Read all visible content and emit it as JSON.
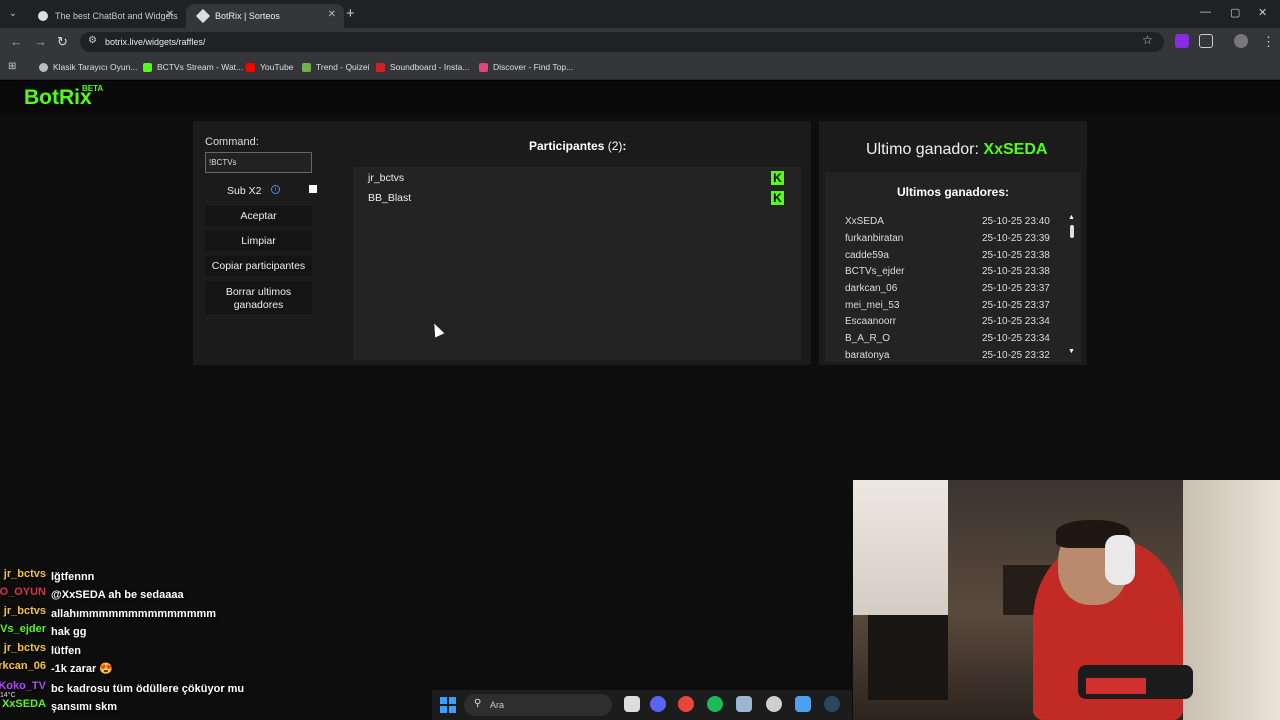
{
  "browser": {
    "tabs": [
      {
        "title": "The best ChatBot and Widgets",
        "active": false
      },
      {
        "title": "BotRix | Sorteos",
        "active": true
      }
    ],
    "url": "botrix.live/widgets/raffles/",
    "bookmarks": [
      {
        "label": "Klasik Tarayıcı Oyun...",
        "color": "#bbbbbb"
      },
      {
        "label": "BCTVs Stream - Wat...",
        "color": "#53fc18"
      },
      {
        "label": "YouTube",
        "color": "#ff0000"
      },
      {
        "label": "Trend - Quizei",
        "color": "#6fb04f"
      },
      {
        "label": "Soundboard - Insta...",
        "color": "#d42020"
      },
      {
        "label": "Discover - Find Top...",
        "color": "#e0457b"
      }
    ]
  },
  "site": {
    "logo": "BotRix",
    "logo_badge": "BETA",
    "accent": "#53fc18"
  },
  "raffle": {
    "command_label": "Command:",
    "command_value": "!BCTVs",
    "sub_label": "Sub X2",
    "buttons": {
      "accept": "Aceptar",
      "clear": "Limpiar",
      "copy": "Copiar participantes",
      "delete": "Borrar ultimos ganadores"
    },
    "participants_title": "Participantes",
    "participants_count": "(2)",
    "participants_colon": ":",
    "participants": [
      "jr_bctvs",
      "BB_Blast"
    ]
  },
  "winners": {
    "last_label": "Ultimo ganador:",
    "last_name": "XxSEDA",
    "list_title": "Ultimos ganadores:",
    "list": [
      {
        "name": "XxSEDA",
        "date": "25-10-25 23:40"
      },
      {
        "name": "furkanbiratan",
        "date": "25-10-25 23:39"
      },
      {
        "name": "cadde59a",
        "date": "25-10-25 23:38"
      },
      {
        "name": "BCTVs_ejder",
        "date": "25-10-25 23:38"
      },
      {
        "name": "darkcan_06",
        "date": "25-10-25 23:37"
      },
      {
        "name": "mei_mei_53",
        "date": "25-10-25 23:37"
      },
      {
        "name": "Escaanoorr",
        "date": "25-10-25 23:34"
      },
      {
        "name": "B_A_R_O",
        "date": "25-10-25 23:34"
      },
      {
        "name": "baratonya",
        "date": "25-10-25 23:32"
      }
    ]
  },
  "chat": [
    {
      "user": "jr_bctvs",
      "msg": "lğtfennn",
      "color": "#f7c531"
    },
    {
      "user": "O_OYUN",
      "msg": "@XxSEDA ah be sedaaaa",
      "color": "#e0304a"
    },
    {
      "user": "jr_bctvs",
      "msg": "allahımmmmmmmmmmmmmm",
      "color": "#f7c531"
    },
    {
      "user": "Vs_ejder",
      "msg": "hak gg",
      "color": "#53fc18"
    },
    {
      "user": "jr_bctvs",
      "msg": "lütfen",
      "color": "#f7c531"
    },
    {
      "user": "rkcan_06",
      "msg": "-1k zarar 😍",
      "color": "#f7c531"
    },
    {
      "user": "Koko_TV",
      "msg": "bc kadrosu tüm ödüllere çöküyor mu",
      "color": "#b04bff"
    },
    {
      "user": "XxSEDA",
      "msg": "şansımı skm",
      "color": "#53fc18"
    }
  ],
  "taskbar": {
    "search_placeholder": "Ara",
    "weather": "14°C"
  }
}
